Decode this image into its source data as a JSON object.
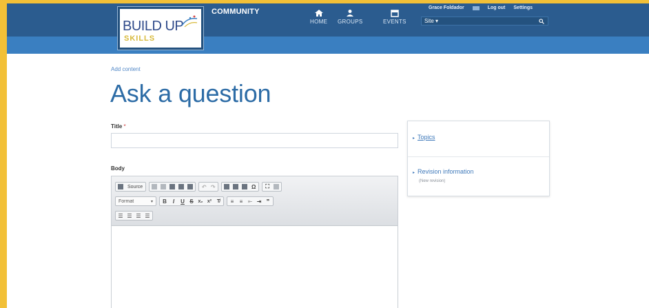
{
  "header": {
    "logo_main": "BUILD UP",
    "logo_sub": "SKILLS",
    "community": "COMMUNITY",
    "nav": [
      {
        "label": "HOME",
        "icon": "home-icon"
      },
      {
        "label": "GROUPS",
        "icon": "groups-icon"
      },
      {
        "label": "EVENTS",
        "icon": "events-icon"
      }
    ],
    "user": {
      "name": "Grace Foldador",
      "logout": "Log out",
      "settings": "Settings"
    },
    "search": {
      "scope": "Site ▾",
      "icon": "search-icon"
    }
  },
  "breadcrumb": "Add content",
  "page_title": "Ask a question",
  "form": {
    "title_label": "Title",
    "title_required": "*",
    "title_value": "",
    "body_label": "Body",
    "editor": {
      "source_label": "Source",
      "format_label": "Format",
      "bold": "B",
      "italic": "I",
      "underline": "U",
      "strike": "S",
      "omega": "Ω",
      "quote": "❞"
    }
  },
  "sidebar": {
    "topics": "Topics",
    "revision": "Revision information",
    "revision_sub": "(New revision)"
  },
  "colors": {
    "header_bg": "#2b5c8f",
    "header_strip": "#3a7fc1",
    "title_blue": "#2d6ca6",
    "link_blue": "#3f79ba",
    "frame_border": "#f2c037"
  }
}
